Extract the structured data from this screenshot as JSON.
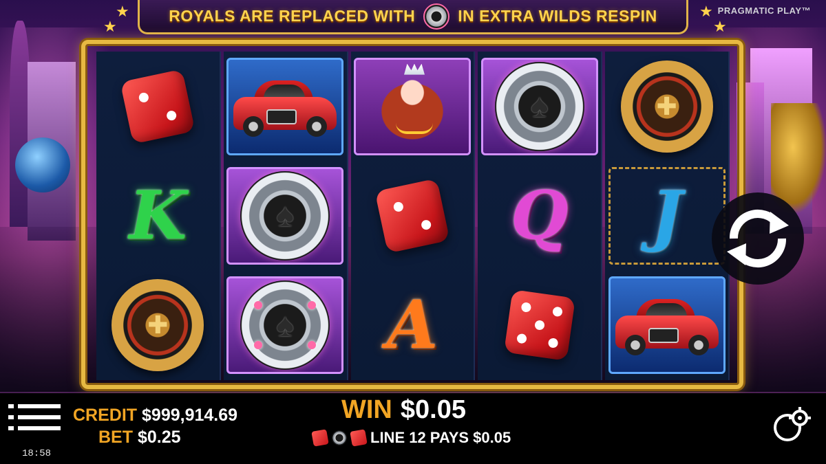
{
  "banner": {
    "text_before": "ROYALS ARE REPLACED WITH",
    "text_after": "IN EXTRA WILDS RESPIN",
    "icon": "poker-chip-wild-icon"
  },
  "brand": "PRAGMATIC PLAY™",
  "reels": [
    [
      "dice",
      "car",
      "chip",
      "queen_lady",
      "roulette"
    ],
    [
      "K",
      "chip",
      "dice",
      "Q",
      "J"
    ],
    [
      "roulette",
      "chip",
      "A",
      "dice",
      "car"
    ]
  ],
  "reel_columns": [
    {
      "symbols": [
        "dice",
        "K",
        "roulette"
      ]
    },
    {
      "symbols": [
        "car",
        "chip",
        "chip"
      ]
    },
    {
      "symbols": [
        "lady",
        "dice",
        "A"
      ]
    },
    {
      "symbols": [
        "chip",
        "Q",
        "dice"
      ]
    },
    {
      "symbols": [
        "roulette",
        "J",
        "car"
      ]
    }
  ],
  "symbols": {
    "K": "K",
    "Q": "Q",
    "J": "J",
    "A": "A"
  },
  "hud": {
    "credit_label": "CREDIT",
    "credit_value": "$999,914.69",
    "bet_label": "BET",
    "bet_value": "$0.25",
    "win_label": "WIN",
    "win_value": "$0.05",
    "line_text": "LINE 12 PAYS $0.05",
    "time": "18:58"
  },
  "colors": {
    "gold": "#e7b942",
    "label_orange": "#f1a524",
    "banner_text": "#ffd34d"
  }
}
